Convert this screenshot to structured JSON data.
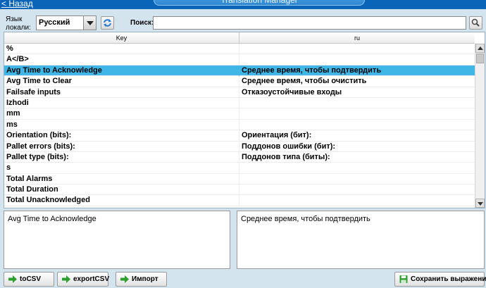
{
  "header": {
    "back_label": "< Назад",
    "title": "Translation Manager"
  },
  "toolbar": {
    "locale_label": "Язык локали:",
    "locale_value": "Русский",
    "search_label": "Поиск:",
    "search_value": ""
  },
  "grid": {
    "columns": [
      "Key",
      "ru"
    ],
    "rows": [
      {
        "key": "%",
        "value": ""
      },
      {
        "key": "A</B>",
        "value": ""
      },
      {
        "key": "Avg Time to Acknowledge",
        "value": " Среднее время, чтобы подтвердить",
        "selected": true
      },
      {
        "key": "Avg Time to Clear",
        "value": " Среднее время, чтобы очистить"
      },
      {
        "key": "Failsafe inputs",
        "value": "Отказоустойчивые входы"
      },
      {
        "key": "Izhodi",
        "value": ""
      },
      {
        "key": "mm",
        "value": ""
      },
      {
        "key": "ms",
        "value": ""
      },
      {
        "key": "Orientation (bits):",
        "value": " Ориентация (бит):"
      },
      {
        "key": "Pallet errors (bits):",
        "value": "Поддонов ошибки (бит):"
      },
      {
        "key": "Pallet type (bits):",
        "value": "Поддонов типа (биты):"
      },
      {
        "key": "s",
        "value": ""
      },
      {
        "key": "Total Alarms",
        "value": ""
      },
      {
        "key": "Total Duration",
        "value": ""
      },
      {
        "key": "Total Unacknowledged",
        "value": ""
      }
    ]
  },
  "editors": {
    "key_text": "Avg Time to Acknowledge",
    "value_text": "Среднее время, чтобы подтвердить"
  },
  "buttons": {
    "tocsv": "toCSV",
    "exportcsv": "exportCSV",
    "import": "Импорт",
    "save": "Сохранить выражение"
  },
  "colors": {
    "topbar": "#0a64b8",
    "selected_row": "#3fb6e6",
    "background": "#d4e4ee"
  },
  "icons": {
    "refresh": "refresh-icon",
    "search": "search-icon",
    "tocsv": "green-arrow-icon",
    "exportcsv": "green-arrow-icon",
    "import": "green-arrow-icon",
    "save": "floppy-disk-icon"
  }
}
